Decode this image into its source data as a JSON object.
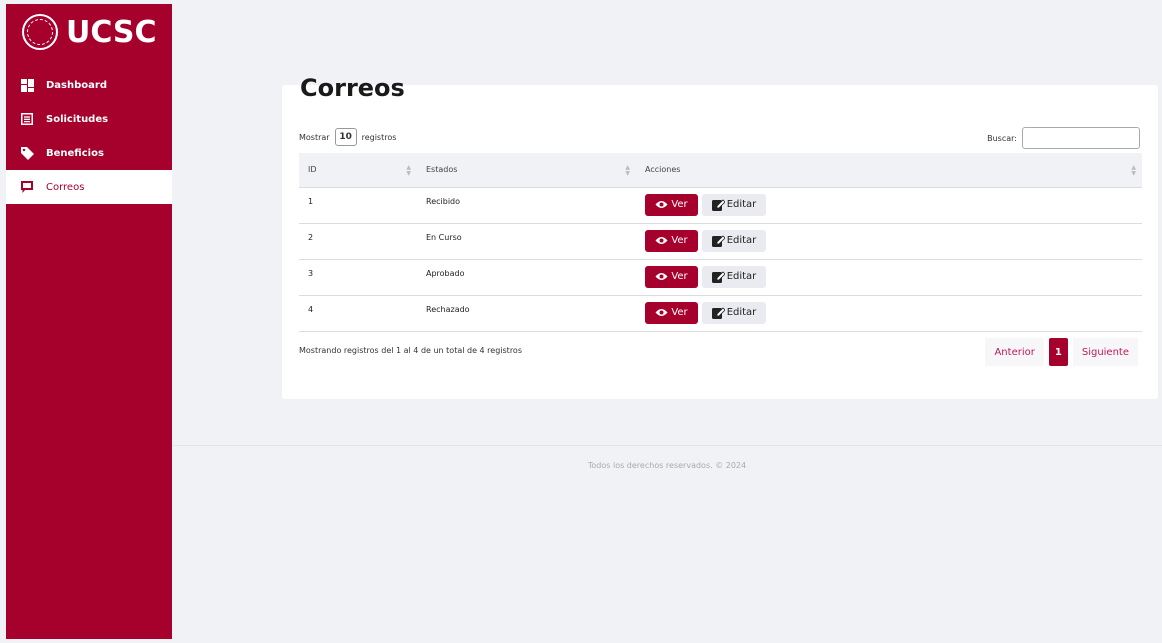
{
  "brand": {
    "name": "UCSC",
    "primary_color": "#a6002c"
  },
  "sidebar": {
    "items": [
      {
        "label": "Dashboard",
        "icon": "dashboard-icon",
        "active": false
      },
      {
        "label": "Solicitudes",
        "icon": "list-icon",
        "active": false
      },
      {
        "label": "Beneficios",
        "icon": "tag-icon",
        "active": false
      },
      {
        "label": "Correos",
        "icon": "message-icon",
        "active": true
      }
    ]
  },
  "page": {
    "title": "Correos"
  },
  "table_controls": {
    "show_prefix": "Mostrar",
    "show_value": "10",
    "show_suffix": "registros",
    "search_label": "Buscar:",
    "search_value": ""
  },
  "table": {
    "columns": [
      "ID",
      "Estados",
      "Acciones"
    ],
    "rows": [
      {
        "id": "1",
        "estado": "Recibido"
      },
      {
        "id": "2",
        "estado": "En Curso"
      },
      {
        "id": "3",
        "estado": "Aprobado"
      },
      {
        "id": "4",
        "estado": "Rechazado"
      }
    ],
    "view_label": "Ver",
    "edit_label": "Editar"
  },
  "footer_info": "Mostrando registros del 1 al 4 de un total de 4 registros",
  "pagination": {
    "prev": "Anterior",
    "current": "1",
    "next": "Siguiente"
  },
  "footer": {
    "text": "Todos los derechos reservados. © 2024"
  }
}
